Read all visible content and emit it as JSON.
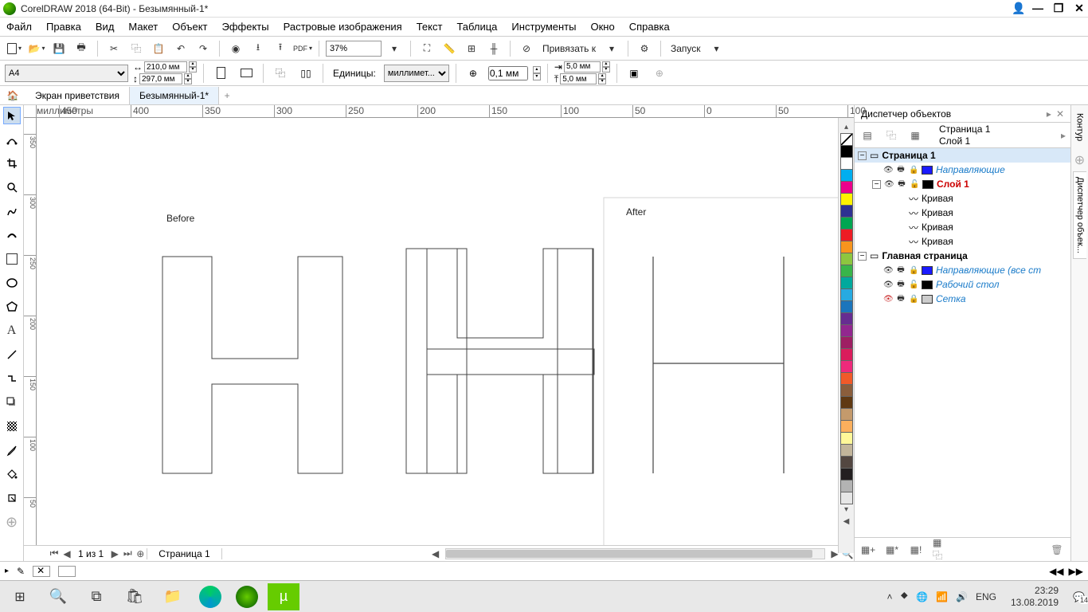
{
  "title": "CorelDRAW 2018 (64-Bit) - Безымянный-1*",
  "menu": {
    "file": "Файл",
    "edit": "Правка",
    "view": "Вид",
    "layout": "Макет",
    "object": "Объект",
    "effects": "Эффекты",
    "bitmaps": "Растровые изображения",
    "text": "Текст",
    "table": "Таблица",
    "tools": "Инструменты",
    "window": "Окно",
    "help": "Справка"
  },
  "toolbar": {
    "zoom": "37%",
    "snap_label": "Привязать к",
    "launch_label": "Запуск"
  },
  "property": {
    "page_size": "A4",
    "width": "210,0 мм",
    "height": "297,0 мм",
    "units_label": "Единицы:",
    "units": "миллимет...",
    "nudge": "0,1 мм",
    "dup_x": "5,0 мм",
    "dup_y": "5,0 мм"
  },
  "tabs": {
    "welcome": "Экран приветствия",
    "doc": "Безымянный-1*"
  },
  "ruler": {
    "unit_label": "миллиметры",
    "h": [
      "-450",
      "-400",
      "-350",
      "-300",
      "-250",
      "-200",
      "-150",
      "-100",
      "-50",
      "0",
      "50",
      "100"
    ],
    "v": [
      "350",
      "300",
      "250",
      "200",
      "150",
      "100",
      "50"
    ]
  },
  "canvas": {
    "before": "Before",
    "after": "After"
  },
  "page_nav": {
    "page_of": "1   из   1",
    "page_tab": "Страница 1"
  },
  "docker": {
    "title": "Диспетчер объектов",
    "page": "Страница 1",
    "layer": "Слой 1",
    "tree": {
      "page1": "Страница 1",
      "guides": "Направляющие",
      "layer1": "Слой 1",
      "curve": "Кривая",
      "master": "Главная страница",
      "guides_all": "Направляющие (все ст",
      "desktop": "Рабочий стол",
      "grid": "Сетка"
    },
    "vtab_contour": "Контур",
    "vtab_manager": "Диспетчер объек..."
  },
  "taskbar": {
    "lang": "ENG",
    "time": "23:29",
    "date": "13.08.2019",
    "notif": "14"
  }
}
